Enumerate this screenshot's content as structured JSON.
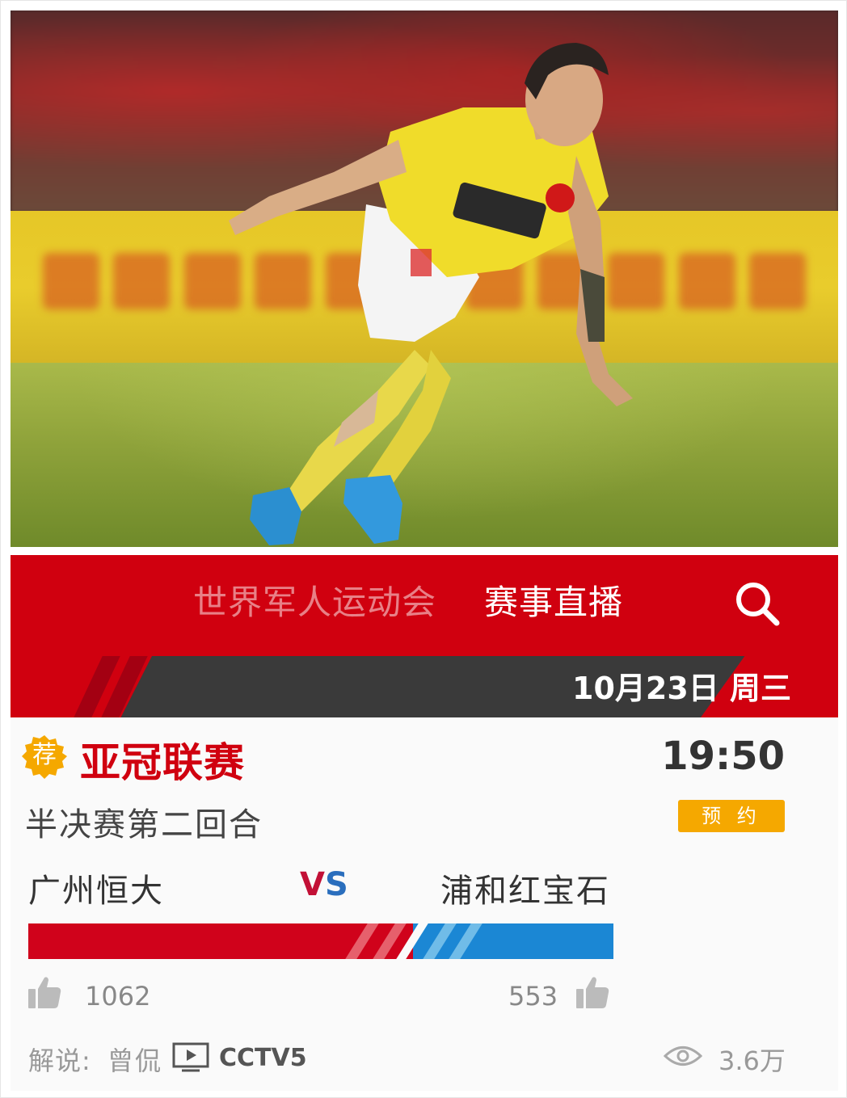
{
  "nav": {
    "tab_inactive": "世界军人运动会",
    "tab_active": "赛事直播"
  },
  "date_label": "10月23日 周三",
  "match": {
    "badge": "荐",
    "league": "亚冠联赛",
    "time": "19:50",
    "round": "半决赛第二回合",
    "reserve_label": "预 约",
    "home_team": "广州恒大",
    "vs_v": "V",
    "vs_s": "S",
    "away_team": "浦和红宝石",
    "home_likes": "1062",
    "away_likes": "553",
    "home_share": 0.658,
    "commentary_label": "解说:",
    "commentator": "曾侃",
    "channel": "CCTV5",
    "views": "3.6万"
  },
  "colors": {
    "brand_red": "#d0000f",
    "home_red": "#d0021b",
    "away_blue": "#1b87d4",
    "reserve_orange": "#f5a800",
    "date_band": "#3a3a3a"
  },
  "icons": [
    "search-icon",
    "recommend-badge-icon",
    "thumbs-up-icon",
    "tv-icon",
    "eye-icon"
  ]
}
